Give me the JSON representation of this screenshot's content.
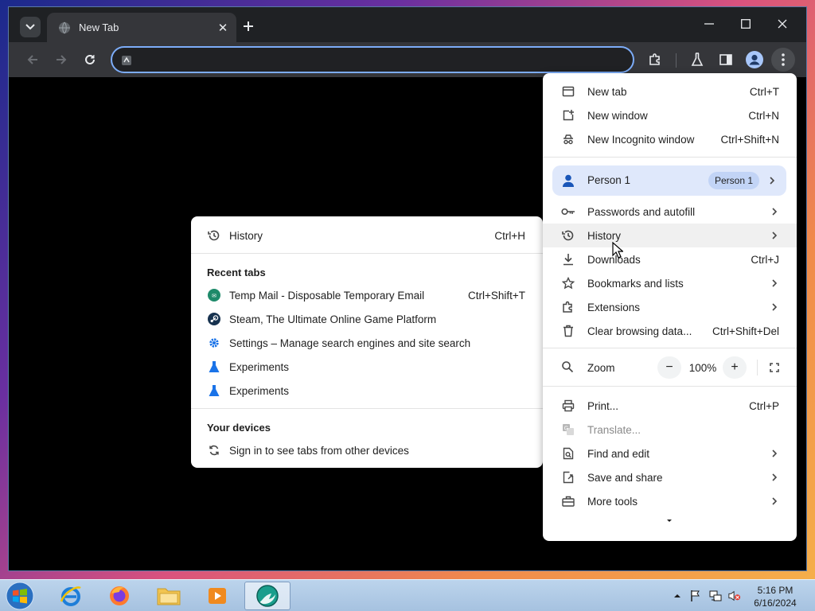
{
  "browser": {
    "tab_title": "New Tab",
    "omnibox_value": ""
  },
  "main_menu": {
    "items_top": [
      {
        "label": "New tab",
        "shortcut": "Ctrl+T"
      },
      {
        "label": "New window",
        "shortcut": "Ctrl+N"
      },
      {
        "label": "New Incognito window",
        "shortcut": "Ctrl+Shift+N"
      }
    ],
    "person": {
      "label": "Person 1",
      "chip": "Person 1"
    },
    "items_mid": [
      {
        "label": "Passwords and autofill",
        "shortcut": ""
      },
      {
        "label": "History",
        "shortcut": ""
      },
      {
        "label": "Downloads",
        "shortcut": "Ctrl+J"
      },
      {
        "label": "Bookmarks and lists",
        "shortcut": ""
      },
      {
        "label": "Extensions",
        "shortcut": ""
      },
      {
        "label": "Clear browsing data...",
        "shortcut": "Ctrl+Shift+Del"
      }
    ],
    "zoom": {
      "label": "Zoom",
      "minus": "−",
      "value": "100%",
      "plus": "+"
    },
    "items_bottom": [
      {
        "label": "Print...",
        "shortcut": "Ctrl+P"
      },
      {
        "label": "Translate...",
        "shortcut": ""
      },
      {
        "label": "Find and edit",
        "shortcut": ""
      },
      {
        "label": "Save and share",
        "shortcut": ""
      },
      {
        "label": "More tools",
        "shortcut": ""
      }
    ]
  },
  "history_menu": {
    "history_item": {
      "label": "History",
      "shortcut": "Ctrl+H"
    },
    "recent_tabs_heading": "Recent tabs",
    "recent_tabs": [
      {
        "label": "Temp Mail - Disposable Temporary Email",
        "shortcut": "Ctrl+Shift+T",
        "icon": "tempmail-icon"
      },
      {
        "label": "Steam, The Ultimate Online Game Platform",
        "shortcut": "",
        "icon": "steam-icon"
      },
      {
        "label": "Settings – Manage search engines and site search",
        "shortcut": "",
        "icon": "settings-gear-icon"
      },
      {
        "label": "Experiments",
        "shortcut": "",
        "icon": "flask-icon"
      },
      {
        "label": "Experiments",
        "shortcut": "",
        "icon": "flask-icon"
      }
    ],
    "devices_heading": "Your devices",
    "devices_item": {
      "label": "Sign in to see tabs from other devices"
    }
  },
  "taskbar": {
    "time": "5:16 PM",
    "date": "6/16/2024"
  },
  "colors": {
    "accent_blue": "#1a73e8",
    "omnibox_focus": "#7cacf8",
    "menu_bg": "#ffffff",
    "toolbar_bg": "#35363a",
    "frame_bg": "#1f2124"
  }
}
